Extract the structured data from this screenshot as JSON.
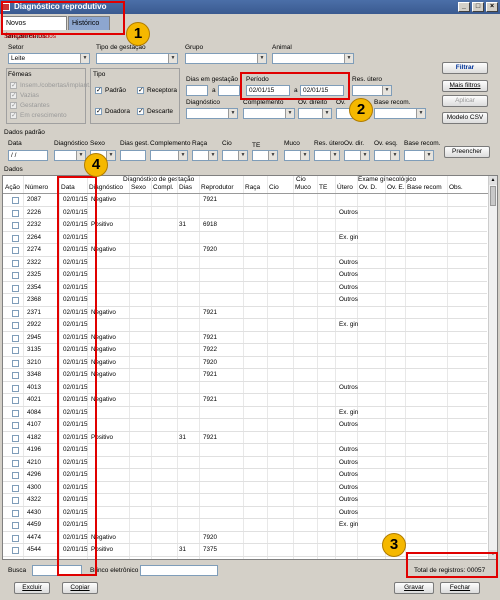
{
  "window": {
    "title": "Diagnóstico reprodutivo"
  },
  "tabs": [
    {
      "label": "Novos lançamentos"
    },
    {
      "label": "Histórico"
    }
  ],
  "selection": {
    "title": "Seleção de dados",
    "setor_label": "Setor",
    "setor_value": "Leite",
    "tipo_gestacao_label": "Tipo de gestação",
    "grupo_label": "Grupo",
    "animal_label": "Animal",
    "femeas_label": "Fêmeas",
    "femeas": [
      "Insem./cobertas/implant.",
      "Vazias",
      "Gestantes",
      "Em crescimento"
    ],
    "tipo_label": "Tipo",
    "tipo": [
      "Padrão",
      "Receptora",
      "Doadora",
      "Descarte"
    ],
    "dias_gestacao_label": "Dias em gestação",
    "a_label": "a",
    "periodo_label": "Período",
    "periodo_from": "02/01/15",
    "periodo_to": "02/01/15",
    "res_utero_label": "Res. útero",
    "diagnostico_label": "Diagnóstico",
    "complemento_label": "Complemento",
    "ov_direito_label": "Ov. direito",
    "ov_esquerdo_label": "Ov.",
    "base_recom_label": "Base recom."
  },
  "buttons": {
    "filtrar": "Filtrar",
    "mais_filtros": "Mais filtros",
    "aplicar": "Aplicar",
    "modelo_csv": "Modelo CSV",
    "preencher": "Preencher",
    "excluir": "Excluir",
    "copiar": "Copiar",
    "gravar": "Gravar",
    "fechar": "Fechar"
  },
  "dados_padrao": {
    "title": "Dados padrão",
    "labels": [
      "Data",
      "Diagnóstico",
      "Sexo",
      "Dias gest.",
      "Complemento",
      "Raça",
      "Cio",
      "TE",
      "Muco",
      "Res. útero",
      "Ov. dir.",
      "Ov. esq.",
      "Base recom."
    ],
    "data_value": " / /"
  },
  "grid": {
    "title": "Dados",
    "group_headers": [
      "Diagnóstico de gestação",
      "Cio",
      "Exame ginecológico"
    ],
    "columns": [
      "Ação",
      "Número",
      "Data",
      "Diagnóstico",
      "Sexo",
      "Compl.",
      "Dias",
      "Reprodutor",
      "Raça",
      "Cio",
      "Muco",
      "TE",
      "Útero",
      "Ov. D.",
      "Ov. E.",
      "Base recom",
      "Obs."
    ],
    "rows": [
      {
        "numero": "2087",
        "data": "02/01/15",
        "diag": "Negativo",
        "dias": "",
        "repro": "7921",
        "utero": ""
      },
      {
        "numero": "2226",
        "data": "02/01/15",
        "diag": "",
        "dias": "",
        "repro": "",
        "utero": "Outros"
      },
      {
        "numero": "2232",
        "data": "02/01/15",
        "diag": "Positivo",
        "dias": "31",
        "repro": "6918",
        "utero": ""
      },
      {
        "numero": "2264",
        "data": "02/01/15",
        "diag": "",
        "dias": "",
        "repro": "",
        "utero": "Ex. gin"
      },
      {
        "numero": "2274",
        "data": "02/01/15",
        "diag": "Negativo",
        "dias": "",
        "repro": "7920",
        "utero": ""
      },
      {
        "numero": "2322",
        "data": "02/01/15",
        "diag": "",
        "dias": "",
        "repro": "",
        "utero": "Outros"
      },
      {
        "numero": "2325",
        "data": "02/01/15",
        "diag": "",
        "dias": "",
        "repro": "",
        "utero": "Outros"
      },
      {
        "numero": "2354",
        "data": "02/01/15",
        "diag": "",
        "dias": "",
        "repro": "",
        "utero": "Outros"
      },
      {
        "numero": "2368",
        "data": "02/01/15",
        "diag": "",
        "dias": "",
        "repro": "",
        "utero": "Outros"
      },
      {
        "numero": "2371",
        "data": "02/01/15",
        "diag": "Negativo",
        "dias": "",
        "repro": "7921",
        "utero": ""
      },
      {
        "numero": "2922",
        "data": "02/01/15",
        "diag": "",
        "dias": "",
        "repro": "",
        "utero": "Ex. gin"
      },
      {
        "numero": "2945",
        "data": "02/01/15",
        "diag": "Negativo",
        "dias": "",
        "repro": "7921",
        "utero": ""
      },
      {
        "numero": "3135",
        "data": "02/01/15",
        "diag": "Negativo",
        "dias": "",
        "repro": "7922",
        "utero": ""
      },
      {
        "numero": "3210",
        "data": "02/01/15",
        "diag": "Negativo",
        "dias": "",
        "repro": "7920",
        "utero": ""
      },
      {
        "numero": "3348",
        "data": "02/01/15",
        "diag": "Negativo",
        "dias": "",
        "repro": "7921",
        "utero": ""
      },
      {
        "numero": "4013",
        "data": "02/01/15",
        "diag": "",
        "dias": "",
        "repro": "",
        "utero": "Outros"
      },
      {
        "numero": "4021",
        "data": "02/01/15",
        "diag": "Negativo",
        "dias": "",
        "repro": "7921",
        "utero": ""
      },
      {
        "numero": "4084",
        "data": "02/01/15",
        "diag": "",
        "dias": "",
        "repro": "",
        "utero": "Ex. gin"
      },
      {
        "numero": "4107",
        "data": "02/01/15",
        "diag": "",
        "dias": "",
        "repro": "",
        "utero": "Outros"
      },
      {
        "numero": "4182",
        "data": "02/01/15",
        "diag": "Positivo",
        "dias": "31",
        "repro": "7921",
        "utero": ""
      },
      {
        "numero": "4196",
        "data": "02/01/15",
        "diag": "",
        "dias": "",
        "repro": "",
        "utero": "Outros"
      },
      {
        "numero": "4210",
        "data": "02/01/15",
        "diag": "",
        "dias": "",
        "repro": "",
        "utero": "Outros"
      },
      {
        "numero": "4296",
        "data": "02/01/15",
        "diag": "",
        "dias": "",
        "repro": "",
        "utero": "Outros"
      },
      {
        "numero": "4300",
        "data": "02/01/15",
        "diag": "",
        "dias": "",
        "repro": "",
        "utero": "Outros"
      },
      {
        "numero": "4322",
        "data": "02/01/15",
        "diag": "",
        "dias": "",
        "repro": "",
        "utero": "Outros"
      },
      {
        "numero": "4430",
        "data": "02/01/15",
        "diag": "",
        "dias": "",
        "repro": "",
        "utero": "Outros"
      },
      {
        "numero": "4459",
        "data": "02/01/15",
        "diag": "",
        "dias": "",
        "repro": "",
        "utero": "Ex. gin"
      },
      {
        "numero": "4474",
        "data": "02/01/15",
        "diag": "Negativo",
        "dias": "",
        "repro": "7920",
        "utero": ""
      },
      {
        "numero": "4544",
        "data": "02/01/15",
        "diag": "Positivo",
        "dias": "31",
        "repro": "7375",
        "utero": ""
      }
    ]
  },
  "footer": {
    "busca_label": "Busca",
    "brinco_label": "Brinco eletrônico",
    "total_label": "Total de registros: 00057"
  },
  "callouts": [
    "1",
    "2",
    "3",
    "4"
  ],
  "colors": {
    "callout_border": "#e00000",
    "badge_fill": "#f5b800",
    "titlebar": "#3a5a90"
  }
}
